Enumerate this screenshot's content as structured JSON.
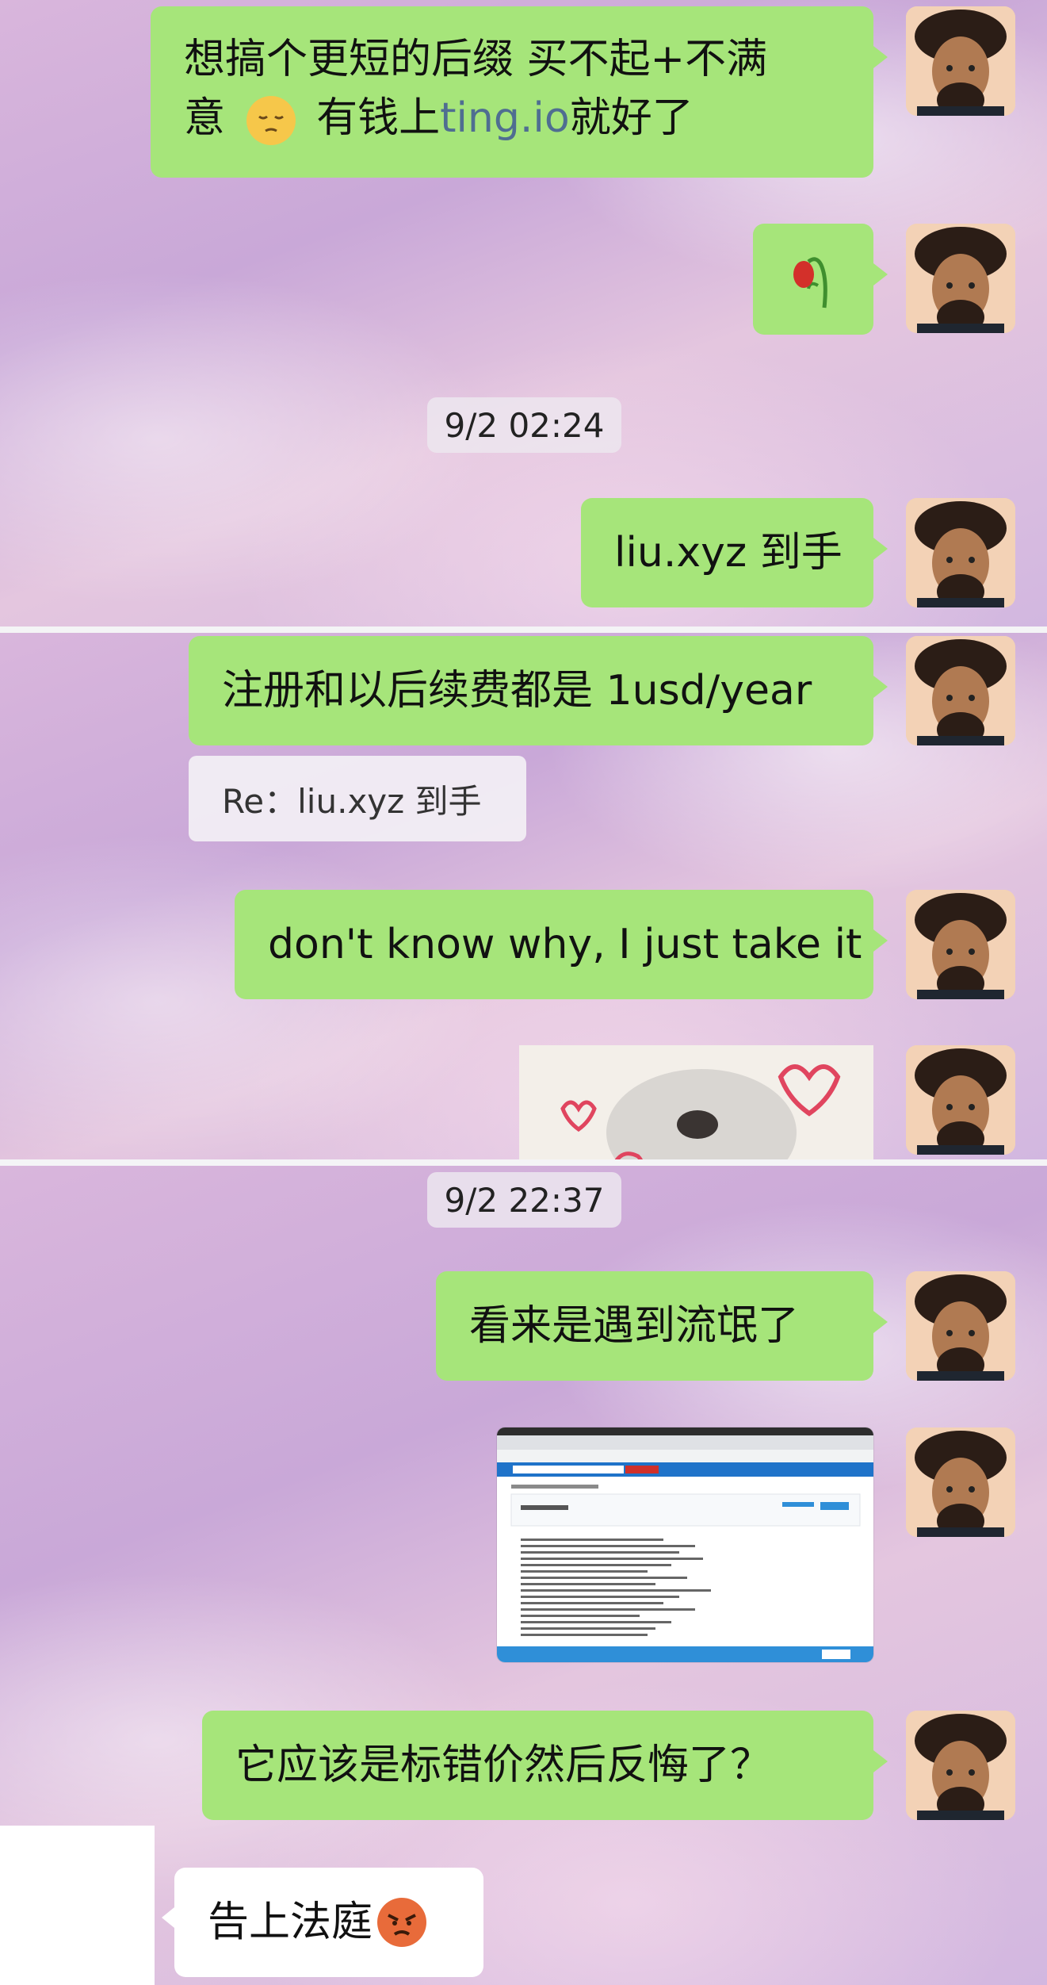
{
  "colors": {
    "my_bubble": "#a6e57a",
    "their_bubble": "#ffffff",
    "link": "#4f6e91"
  },
  "messages": {
    "m1": {
      "line1": "想搞个更短的后缀 买不起+不满",
      "pre": "意",
      "mid": "有钱上",
      "link": "ting.io",
      "post": "就好了",
      "emoji": "pensive-face"
    },
    "m2": {
      "sticker": "wilted-flower"
    },
    "m3": {
      "text": "liu.xyz 到手"
    },
    "m4": {
      "text": "注册和以后续费都是 1usd/year"
    },
    "m4_quote": {
      "text": "Re：liu.xyz 到手"
    },
    "m5": {
      "text": "don't know why, I just take it"
    },
    "m6": {
      "sticker": "cat-with-hearts"
    },
    "m7": {
      "text": "看来是遇到流氓了"
    },
    "m8": {
      "image": "browser-screenshot"
    },
    "m9": {
      "text": "它应该是标错价然后反悔了？"
    },
    "m10": {
      "text": "告上法庭",
      "emoji": "angry-face"
    }
  },
  "timestamps": {
    "t1": "9/2 02:24",
    "t2": "9/2 22:37"
  }
}
